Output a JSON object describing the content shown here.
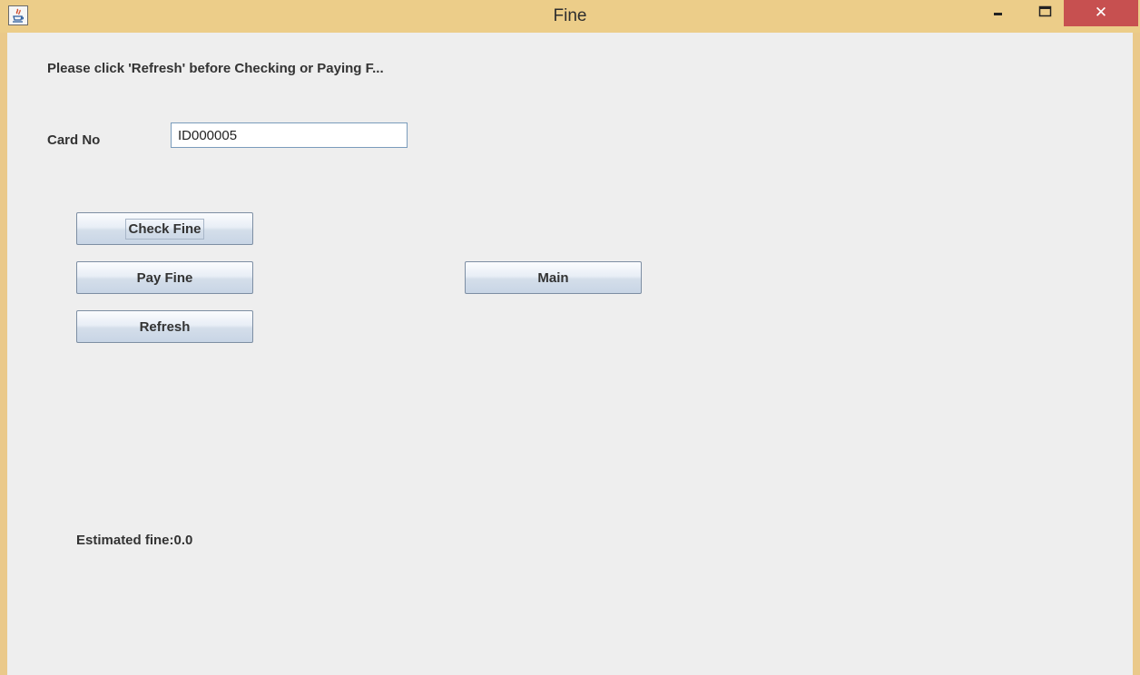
{
  "window": {
    "title": "Fine",
    "app_icon": "java-icon",
    "controls": {
      "minimize_icon": "minimize-icon",
      "maximize_icon": "maximize-icon",
      "close_icon": "close-icon",
      "close_glyph": "✕"
    }
  },
  "form": {
    "notice": "Please click 'Refresh' before Checking or Paying F...",
    "card_label": "Card No",
    "card_value": "ID000005",
    "buttons": {
      "check_fine": "Check Fine",
      "pay_fine": "Pay Fine",
      "refresh": "Refresh",
      "main": "Main"
    },
    "estimated_fine": "Estimated fine:0.0"
  },
  "colors": {
    "title_bar": "#eccd89",
    "close_button": "#c75050",
    "client_background": "#eeeeee"
  }
}
